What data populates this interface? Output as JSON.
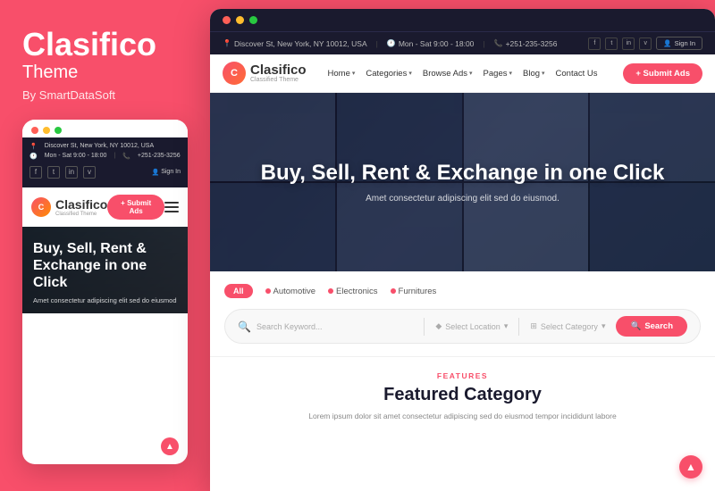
{
  "brand": {
    "title": "Clasifico",
    "subtitle": "Theme",
    "by": "By SmartDataSoft"
  },
  "mobile_preview": {
    "header": {
      "address": "Discover St, New York, NY 10012, USA",
      "hours": "Mon - Sat 9:00 - 18:00",
      "phone": "+251-235-3256",
      "social": [
        "f",
        "t",
        "in",
        "v"
      ],
      "signin": "Sign In"
    },
    "logo": {
      "name": "Clasifico",
      "tagline": "Classified Theme"
    },
    "submit_btn": "+ Submit Ads",
    "hero": {
      "title": "Buy, Sell, Rent & Exchange in one Click",
      "subtitle": "Amet consectetur adipiscing elit sed do eiusmod"
    }
  },
  "desktop_preview": {
    "topbar_dots": [
      "red",
      "yellow",
      "green"
    ],
    "header": {
      "address": "Discover St, New York, NY 10012, USA",
      "hours": "Mon - Sat 9:00 - 18:00",
      "phone": "+251-235-3256",
      "social": [
        "f",
        "t",
        "in",
        "v"
      ],
      "signin": "Sign In"
    },
    "nav": {
      "logo_name": "Clasifico",
      "logo_tagline": "Classified Theme",
      "links": [
        "Home",
        "Categories",
        "Browse Ads",
        "Pages",
        "Blog",
        "Contact Us"
      ],
      "submit_btn": "+ Submit Ads"
    },
    "hero": {
      "title": "Buy, Sell, Rent & Exchange\nin one Click",
      "subtitle": "Amet consectetur adipiscing elit sed do eiusmod."
    },
    "search": {
      "tabs": [
        "All",
        "Automotive",
        "Electronics",
        "Furnitures"
      ],
      "placeholder": "Search Keyword...",
      "location_placeholder": "Select Location",
      "category_placeholder": "Select Category",
      "search_btn": "Search"
    },
    "features": {
      "label": "FEATURES",
      "title": "Featured Category",
      "description": "Lorem ipsum dolor sit amet consectetur adipiscing sed do eiusmod tempor incididunt labore"
    }
  }
}
